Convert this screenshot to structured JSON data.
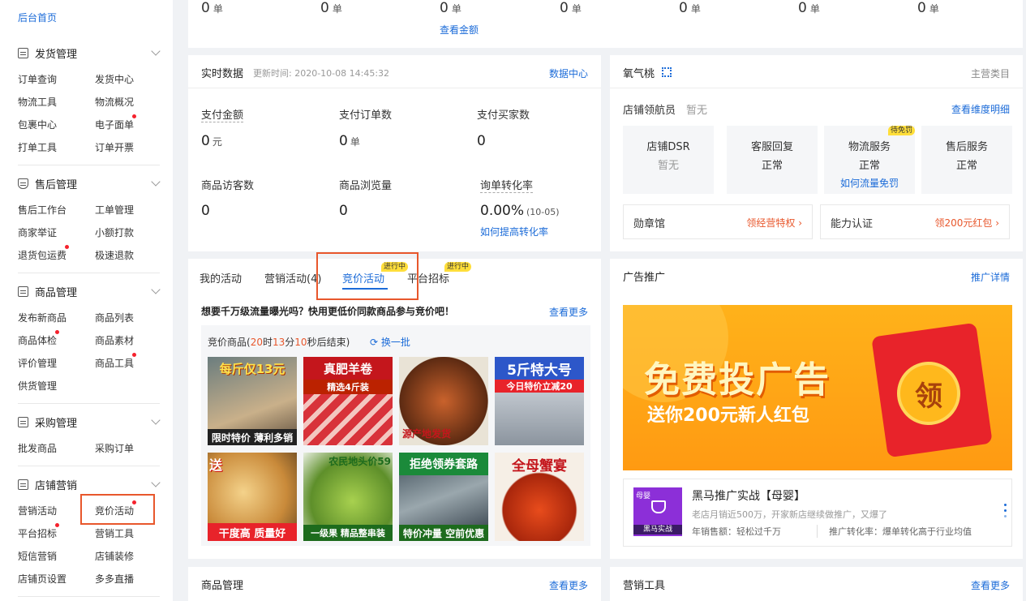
{
  "sidebar": {
    "home": "后台首页",
    "sections": [
      {
        "title": "发货管理",
        "items": [
          "订单查询",
          "发货中心",
          "物流工具",
          "物流概况",
          "包裹中心",
          "电子面单",
          "打单工具",
          "订单开票"
        ]
      },
      {
        "title": "售后管理",
        "items": [
          "售后工作台",
          "工单管理",
          "商家举证",
          "小额打款",
          "退货包运费",
          "极速退款"
        ]
      },
      {
        "title": "商品管理",
        "items": [
          "发布新商品",
          "商品列表",
          "商品体检",
          "商品素材",
          "评价管理",
          "商品工具",
          "供货管理"
        ]
      },
      {
        "title": "采购管理",
        "items": [
          "批发商品",
          "采购订单"
        ]
      },
      {
        "title": "店铺营销",
        "items": [
          "营销活动",
          "竞价活动",
          "平台招标",
          "营销工具",
          "短信营销",
          "店铺装修",
          "店铺页设置",
          "多多直播"
        ]
      }
    ]
  },
  "top_strip": {
    "values": [
      "0",
      "0",
      "0",
      "0",
      "0",
      "0",
      "0"
    ],
    "unit": "单",
    "view_amount": "查看金额"
  },
  "realtime": {
    "title": "实时数据",
    "updated": "更新时间: 2020-10-08 14:45:32",
    "link": "数据中心",
    "stats": [
      {
        "label": "支付金额",
        "value": "0",
        "unit": "元"
      },
      {
        "label": "支付订单数",
        "value": "0",
        "unit": "单"
      },
      {
        "label": "支付买家数",
        "value": "0",
        "unit": ""
      },
      {
        "label": "商品访客数",
        "value": "0",
        "unit": ""
      },
      {
        "label": "商品浏览量",
        "value": "0",
        "unit": ""
      },
      {
        "label": "询单转化率",
        "value": "0.00%",
        "unit": "(10-05)"
      }
    ],
    "improve_link": "如何提高转化率"
  },
  "shop": {
    "name": "氧气桃",
    "category_link": "主营类目",
    "navigator_label": "店铺领航员",
    "navigator_value": "暂无",
    "dimension_link": "查看维度明细",
    "cells": [
      {
        "label": "店铺DSR",
        "value": "暂无"
      },
      {
        "label": "客服回复",
        "value": "正常"
      },
      {
        "label": "物流服务",
        "value": "正常",
        "sub": "如何流量免罚",
        "badge": "待免罚"
      },
      {
        "label": "售后服务",
        "value": "正常"
      }
    ],
    "medal": {
      "label": "勋章馆",
      "action": "领经营特权"
    },
    "ability": {
      "label": "能力认证",
      "action": "领200元红包"
    }
  },
  "activities": {
    "tabs": [
      "我的活动",
      "营销活动(4)",
      "竞价活动",
      "平台招标"
    ],
    "tab_badge": "进行中",
    "promo_text": "想要千万级流量曝光吗？快用更低价同款商品参与竞价吧！",
    "more": "查看更多",
    "bidding_prefix": "竞价商品(",
    "hours": "20",
    "h": "时",
    "minutes": "13",
    "m": "分",
    "seconds": "10",
    "s_suffix": "秒后结束)",
    "refresh": "换一批",
    "products": [
      {
        "top": "每斤仅13元",
        "bottom": "限时特价 薄利多销"
      },
      {
        "top": "真肥羊卷",
        "bottom": "精选4斤装"
      },
      {
        "top": "",
        "bottom": "源产地发货"
      },
      {
        "top": "5斤特大号",
        "bottom": "今日特价立减20"
      },
      {
        "top": "送",
        "bottom": "干度高 质量好"
      },
      {
        "top": "农民地头价59",
        "bottom": "一级果 精品整串装"
      },
      {
        "top": "拒绝领券套路",
        "bottom": "特价冲量 空前优惠"
      },
      {
        "top": "全母蟹宴",
        "bottom": ""
      }
    ]
  },
  "ads": {
    "title": "广告推广",
    "link": "推广详情",
    "banner_main": "免费投广告",
    "banner_sub": "送你200元新人红包",
    "envelope_char": "领",
    "course_icon_top": "母婴",
    "course_icon_bottom": "黑马实战",
    "course_title": "黑马推广实战【母婴】",
    "course_desc": "老店月销近500万，开家新店继续做推广，又爆了",
    "course_stat1": "年销售额：轻松过千万",
    "course_stat2": "推广转化率：爆单转化高于行业均值"
  },
  "bottom": {
    "goods_title": "商品管理",
    "goods_more": "查看更多",
    "tools_title": "营销工具",
    "tools_more": "查看更多"
  },
  "colors": {
    "accent": "#1b6bd8",
    "highlight": "#e8572c",
    "badge": "#ffde3a"
  }
}
